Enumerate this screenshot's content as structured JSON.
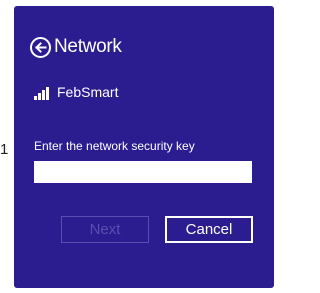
{
  "outside_label": "1",
  "header": {
    "title": "Network",
    "back_icon": "arrow-left-circle-icon"
  },
  "network": {
    "name": "FebSmart",
    "signal_icon": "wifi-signal-bars-icon",
    "signal_bars": 4
  },
  "security_key": {
    "label": "Enter the network security key",
    "value": "",
    "placeholder": ""
  },
  "buttons": {
    "next_label": "Next",
    "next_enabled": false,
    "cancel_label": "Cancel"
  },
  "colors": {
    "panel_background": "#2b1c8f",
    "text": "#ffffff",
    "disabled_button": "#5a4fb0"
  }
}
